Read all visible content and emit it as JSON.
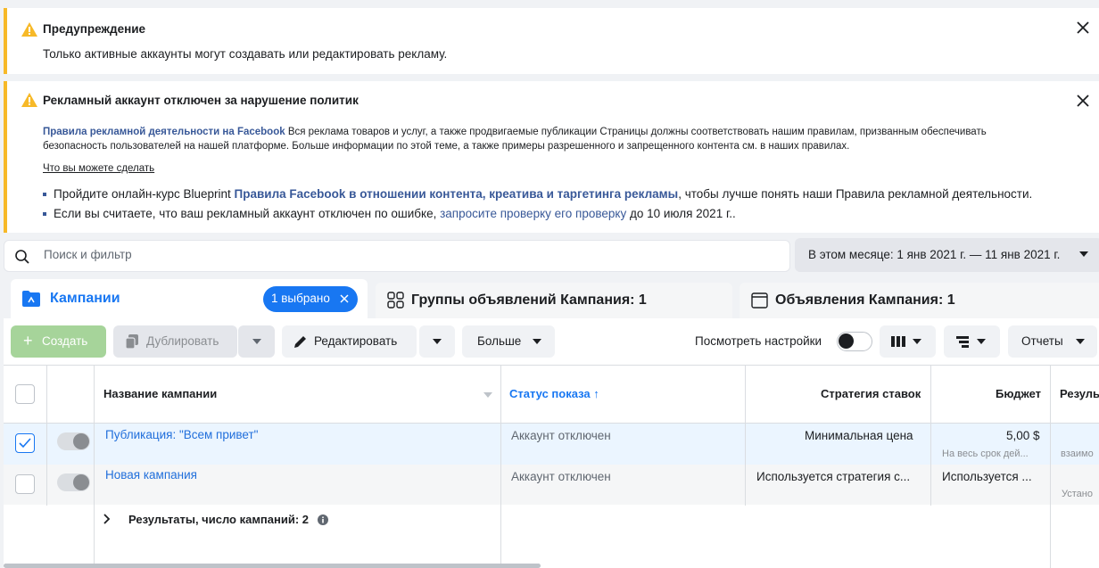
{
  "alerts": {
    "warning": {
      "title": "Предупреждение",
      "text": "Только активные аккаунты могут создавать или редактировать рекламу."
    },
    "disabled": {
      "title": "Рекламный аккаунт отключен за нарушение политик",
      "policy_link": "Правила рекламной деятельности на Facebook",
      "policy_text_1": " Вся реклама товаров и услуг, а также продвигаемые публикации Страницы должны соответствовать нашим правилам, призванным обеспечивать",
      "policy_text_2": "безопасность пользователей на нашей платформе. Больше информации по этой теме, а также примеры разрешенного и запрещенного контента см. в наших правилах.",
      "what_you_can_do": "Что вы можете сделать",
      "bullet1_pre": "Пройдите онлайн-курс Blueprint ",
      "bullet1_link": "Правила Facebook в отношении контента, креатива и таргетинга рекламы",
      "bullet1_post": ", чтобы лучше понять наши Правила рекламной деятельности.",
      "bullet2_pre": "Если вы считаете, что ваш рекламный аккаунт отключен по ошибке, ",
      "bullet2_link": "запросите проверку его проверку",
      "bullet2_post": " до 10 июля 2021 г.."
    }
  },
  "search": {
    "placeholder": "Поиск и фильтр",
    "value": ""
  },
  "date_range": "В этом месяце: 1 янв 2021 г. — 11 янв 2021 г.",
  "tabs": {
    "campaigns": "Кампании",
    "selected_pill": "1 выбрано",
    "adsets": "Группы объявлений Кампания: 1",
    "ads": "Объявления Кампания: 1"
  },
  "toolbar": {
    "create": "Создать",
    "duplicate": "Дублировать",
    "edit": "Редактировать",
    "more": "Больше",
    "view_settings": "Посмотреть настройки",
    "reports": "Отчеты"
  },
  "table": {
    "headers": {
      "name": "Название кампании",
      "status": "Статус показа",
      "bid": "Стратегия ставок",
      "budget": "Бюджет",
      "results": "Резуль"
    },
    "rows": [
      {
        "name": "Публикация: \"Всем привет\"",
        "status": "Аккаунт отключен",
        "bid": "Минимальная цена",
        "budget": "5,00 $",
        "budget_sub": "На весь срок дей...",
        "results_sub": "взаимо",
        "checked": true
      },
      {
        "name": "Новая кампания",
        "status": "Аккаунт отключен",
        "bid": "Используется стратегия с...",
        "budget": "Используется ...",
        "budget_sub": "",
        "results_sub": "Устано",
        "checked": false
      }
    ],
    "summary": "Результаты, число кампаний: 2"
  },
  "colors": {
    "accent": "#1877f2",
    "warning": "#f7b928",
    "link": "#385898",
    "selected_row": "#ebf5ff"
  }
}
